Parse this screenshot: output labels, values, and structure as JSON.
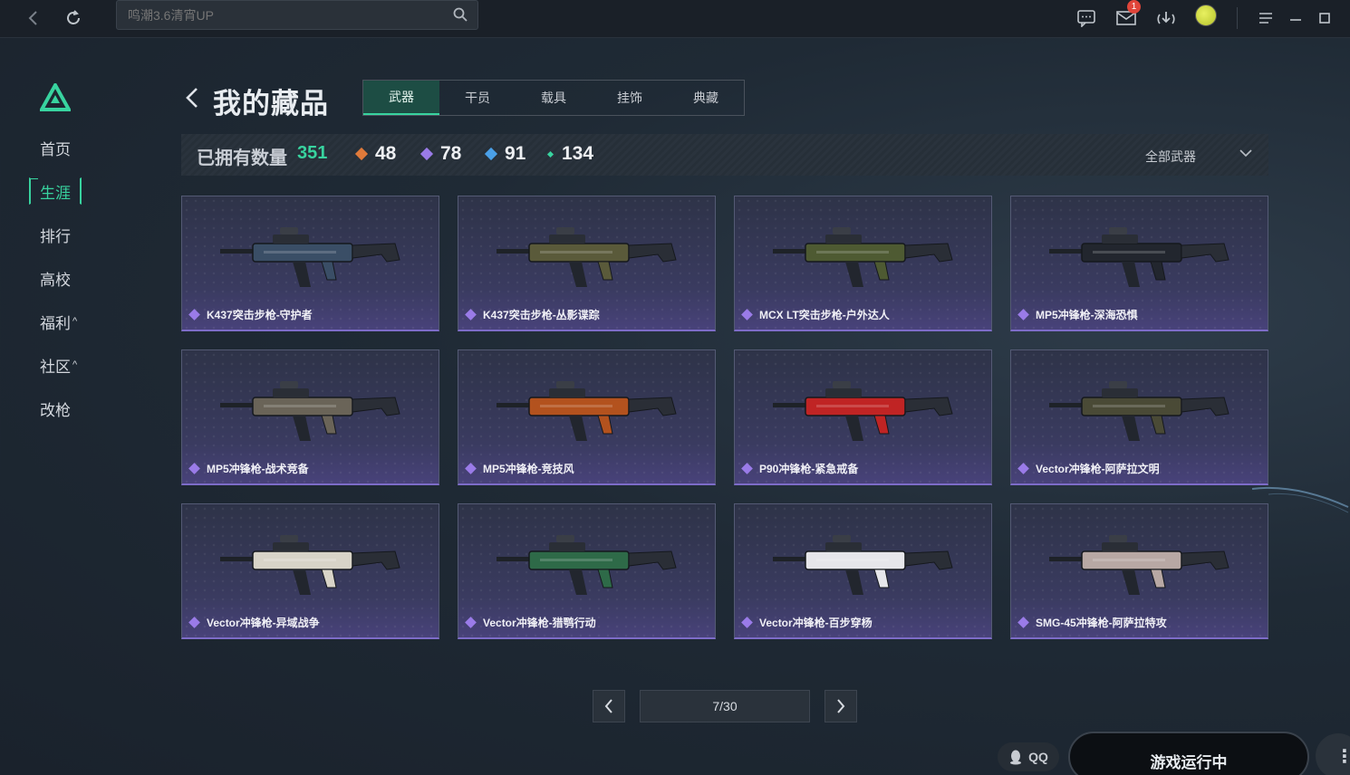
{
  "search": {
    "placeholder": "鸣潮3.6清宵UP"
  },
  "topbar": {
    "mail_badge": "1"
  },
  "sidebar": {
    "items": [
      {
        "label": "首页",
        "active": false
      },
      {
        "label": "生涯",
        "active": true
      },
      {
        "label": "排行",
        "active": false
      },
      {
        "label": "高校",
        "active": false
      },
      {
        "label": "福利",
        "caret": "^",
        "active": false
      },
      {
        "label": "社区",
        "caret": "^",
        "active": false
      },
      {
        "label": "改枪",
        "active": false
      }
    ]
  },
  "header": {
    "title": "我的藏品",
    "tabs": [
      "武器",
      "干员",
      "载具",
      "挂饰",
      "典藏"
    ],
    "active_tab": "武器"
  },
  "stats": {
    "owned_label": "已拥有数量",
    "owned_count": "351",
    "rarities": [
      {
        "value": "48",
        "color": "#e07a3a"
      },
      {
        "value": "78",
        "color": "#9a7be8"
      },
      {
        "value": "91",
        "color": "#4aa0e8"
      },
      {
        "value": "134",
        "color": "#38d39f"
      }
    ],
    "filter": "全部武器"
  },
  "items": [
    {
      "name": "K437突击步枪-守护者",
      "skin": "#3a4e66"
    },
    {
      "name": "K437突击步枪-丛影谍踪",
      "skin": "#5a5a3a"
    },
    {
      "name": "MCX LT突击步枪-户外达人",
      "skin": "#4e5a32"
    },
    {
      "name": "MP5冲锋枪-深海恐惧",
      "skin": "#22262e"
    },
    {
      "name": "MP5冲锋枪-战术竞备",
      "skin": "#6a6458"
    },
    {
      "name": "MP5冲锋枪-竞技风",
      "skin": "#b3521e"
    },
    {
      "name": "P90冲锋枪-紧急戒备",
      "skin": "#c02424"
    },
    {
      "name": "Vector冲锋枪-阿萨拉文明",
      "skin": "#4a4a36"
    },
    {
      "name": "Vector冲锋枪-异域战争",
      "skin": "#d8d4c8"
    },
    {
      "name": "Vector冲锋枪-猎鹗行动",
      "skin": "#2e6a48"
    },
    {
      "name": "Vector冲锋枪-百步穿杨",
      "skin": "#e6e6ea"
    },
    {
      "name": "SMG-45冲锋枪-阿萨拉特攻",
      "skin": "#b8a8a4"
    }
  ],
  "pagination": {
    "indicator": "7/30"
  },
  "footer": {
    "qq_label": "QQ",
    "game_status": "游戏运行中"
  },
  "colors": {
    "accent": "#38d39f",
    "rarity_purple": "#9a7be8"
  }
}
